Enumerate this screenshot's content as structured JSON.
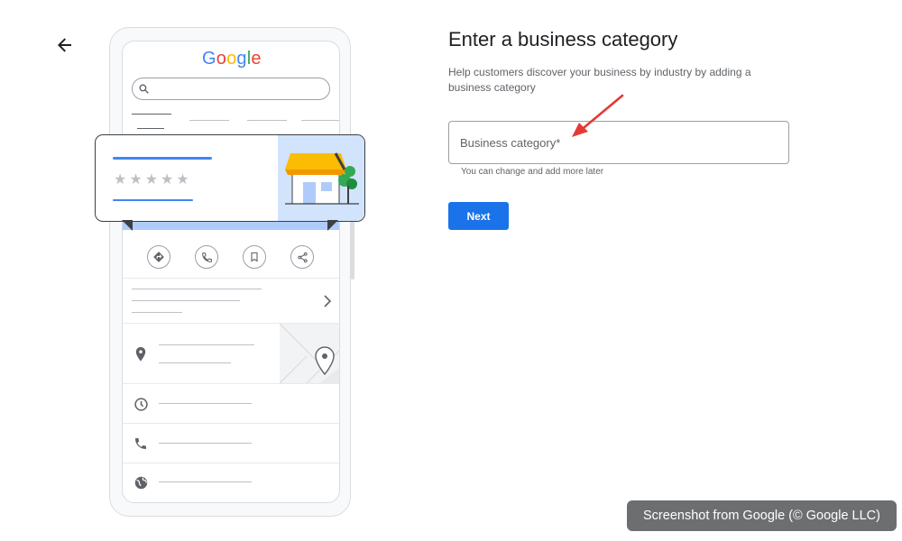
{
  "illustration": {
    "logo_text": "Google",
    "logo_colors": [
      "#4285F4",
      "#EA4335",
      "#FBBC05",
      "#4285F4",
      "#34A853",
      "#EA4335"
    ],
    "rating_stars": 5
  },
  "form": {
    "title": "Enter a business category",
    "description": "Help customers discover your business by industry by adding a business category",
    "category_placeholder": "Business category*",
    "category_value": "",
    "hint": "You can change and add more later",
    "next_label": "Next"
  },
  "accent_color": "#1a73e8",
  "credit": "Screenshot from Google (© Google LLC)"
}
